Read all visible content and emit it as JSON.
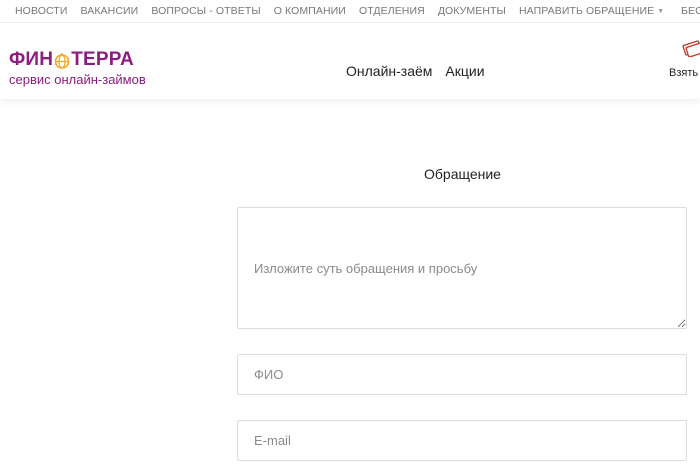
{
  "topnav": {
    "items": [
      {
        "label": "НОВОСТИ"
      },
      {
        "label": "ВАКАНСИИ"
      },
      {
        "label": "ВОПРОСЫ - ОТВЕТЫ"
      },
      {
        "label": "О КОМПАНИИ"
      },
      {
        "label": "ОТДЕЛЕНИЯ"
      },
      {
        "label": "ДОКУМЕНТЫ"
      },
      {
        "label": "НАПРАВИТЬ ОБРАЩЕНИЕ"
      }
    ],
    "right_label": "БЕС"
  },
  "header": {
    "logo": {
      "brand_left": "ФИН",
      "brand_right": "ТЕРРА",
      "tagline": "сервис онлайн-займов",
      "color": "#8b1d7e",
      "accent": "#f5a623"
    },
    "nav": [
      {
        "label": "Онлайн-заём"
      },
      {
        "label": "Акции"
      }
    ],
    "cta": {
      "label": "Взять",
      "icon": "money-icon"
    }
  },
  "form": {
    "title": "Обращение",
    "message_placeholder": "Изложите суть обращения и просьбу",
    "fio_placeholder": "ФИО",
    "email_placeholder": "E-mail"
  }
}
